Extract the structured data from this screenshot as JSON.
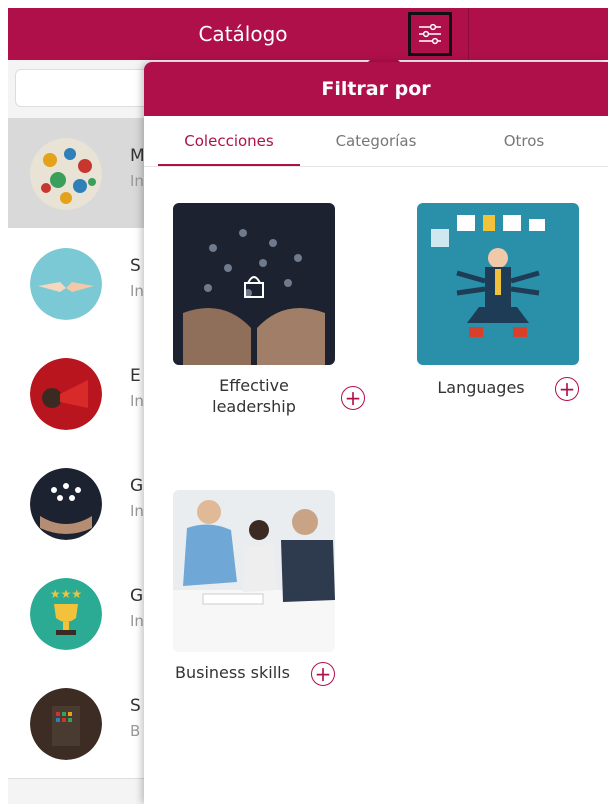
{
  "header": {
    "title": "Catálogo"
  },
  "list": {
    "items": [
      {
        "initial": "M",
        "sub": "In"
      },
      {
        "initial": "S",
        "sub": "In"
      },
      {
        "initial": "E",
        "sub": "In"
      },
      {
        "initial": "G",
        "sub": "In"
      },
      {
        "initial": "G",
        "sub": "In"
      },
      {
        "initial": "S",
        "sub": "B"
      }
    ]
  },
  "filter_panel": {
    "title": "Filtrar por",
    "tabs": [
      "Colecciones",
      "Categorías",
      "Otros"
    ],
    "active_tab": "Colecciones",
    "collections": [
      {
        "label_line1": "Effective",
        "label_line2": "leadership"
      },
      {
        "label_line1": "Languages",
        "label_line2": ""
      },
      {
        "label_line1": "Business skills",
        "label_line2": ""
      }
    ],
    "add_symbol": "+"
  },
  "colors": {
    "brand": "#b0104a",
    "tab_active": "#b0104a"
  }
}
